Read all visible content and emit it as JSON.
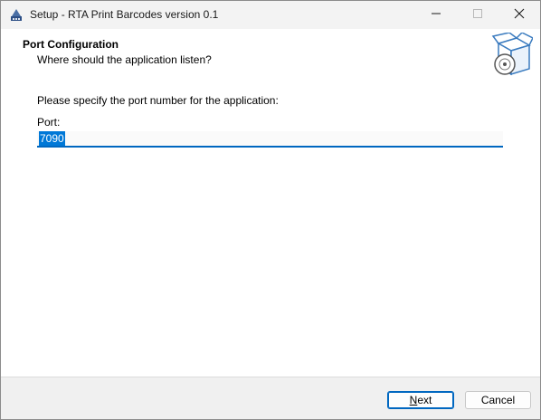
{
  "window": {
    "title": "Setup - RTA Print Barcodes version 0.1"
  },
  "header": {
    "title": "Port Configuration",
    "subtitle": "Where should the application listen?"
  },
  "main": {
    "prompt": "Please specify the port number for the application:",
    "port_label": "Port:",
    "port_value": "7090"
  },
  "footer": {
    "next_label": "Next",
    "cancel_label": "Cancel"
  },
  "icons": {
    "app": "setup-app-icon",
    "header": "package-disc-icon",
    "minimize": "minimize-icon",
    "maximize": "maximize-icon",
    "close": "close-icon"
  },
  "colors": {
    "accent": "#0067c0",
    "selection": "#0078d7"
  }
}
